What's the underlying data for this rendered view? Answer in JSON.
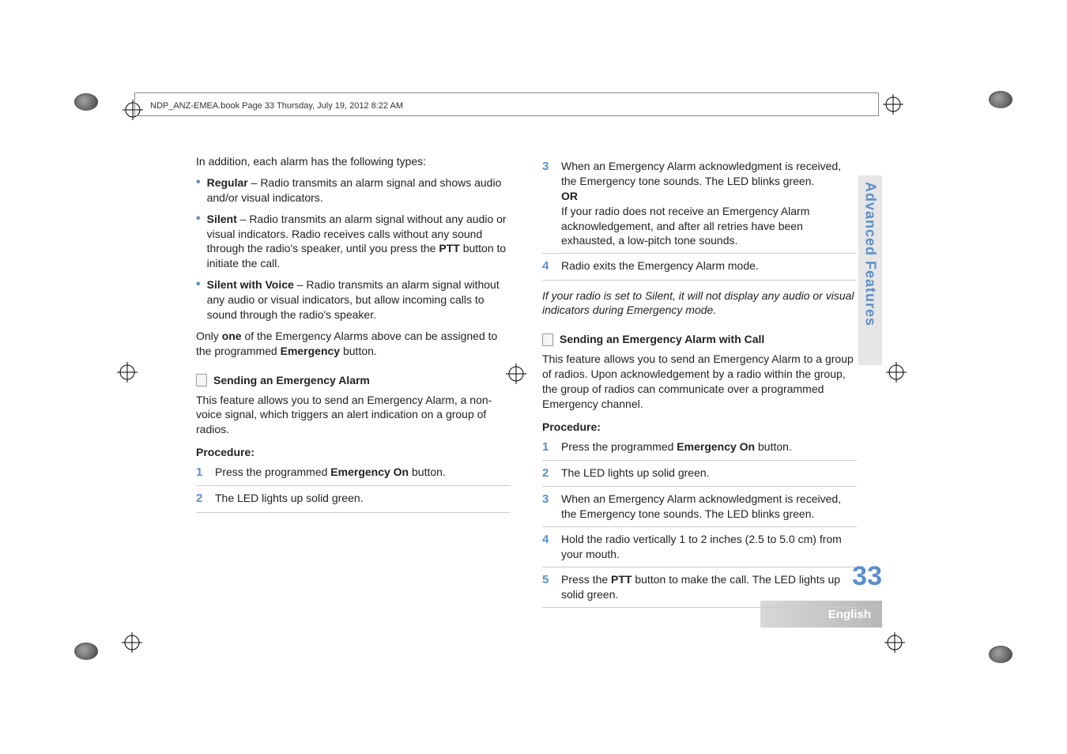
{
  "header": "NDP_ANZ-EMEA.book  Page 33  Thursday, July 19, 2012  8:22 AM",
  "sidebar": "Advanced Features",
  "language": "English",
  "pagenum": "33",
  "left": {
    "intro": "In addition, each alarm has the following types:",
    "bullets": [
      {
        "label": "Regular",
        "sep": " – ",
        "text": "Radio transmits an alarm signal and shows audio and/or visual indicators."
      },
      {
        "label": "Silent",
        "sep": " – ",
        "text": "Radio transmits an alarm signal without any audio or visual indicators. Radio receives calls without any sound through the radio's speaker, until you press the ",
        "bold2": "PTT",
        "tail": " button to initiate the call."
      },
      {
        "label": "Silent with Voice",
        "sep": " – ",
        "text": "Radio transmits an alarm signal without any audio or visual indicators, but allow incoming calls to sound through the radio's speaker."
      }
    ],
    "only_pre": "Only ",
    "only_bold": "one",
    "only_mid": " of the Emergency Alarms above can be assigned to the programmed ",
    "only_bold2": "Emergency",
    "only_post": " button.",
    "sec1_title": "Sending an Emergency Alarm",
    "sec1_body": "This feature allows you to send an Emergency Alarm, a non-voice signal, which triggers an alert indication on a group of radios.",
    "procedure": "Procedure:",
    "steps": [
      {
        "n": "1",
        "pre": "Press the programmed ",
        "bold": "Emergency On",
        "post": " button."
      },
      {
        "n": "2",
        "pre": "The LED lights up solid green.",
        "bold": "",
        "post": ""
      }
    ]
  },
  "right": {
    "steps_a": [
      {
        "n": "3",
        "body1": "When an Emergency Alarm acknowledgment is received, the Emergency tone sounds. The LED blinks green.",
        "or": "OR",
        "body2": "If your radio does not receive an Emergency Alarm acknowledgement, and after all retries have been exhausted, a low-pitch tone sounds."
      },
      {
        "n": "4",
        "body1": "Radio exits the Emergency Alarm mode.",
        "or": "",
        "body2": ""
      }
    ],
    "note": "If your radio is set to Silent, it will not display any audio or visual indicators during Emergency mode.",
    "sec2_title": "Sending an Emergency Alarm with Call",
    "sec2_body": "This feature allows you to send an Emergency Alarm to a group of radios. Upon acknowledgement by a radio within the group, the group of radios can communicate over a programmed Emergency channel.",
    "procedure": "Procedure:",
    "steps_b": [
      {
        "n": "1",
        "pre": "Press the programmed ",
        "bold": "Emergency On",
        "post": " button."
      },
      {
        "n": "2",
        "pre": "The LED lights up solid green.",
        "bold": "",
        "post": ""
      },
      {
        "n": "3",
        "pre": "When an Emergency Alarm acknowledgment is received, the Emergency tone sounds. The LED blinks green.",
        "bold": "",
        "post": ""
      },
      {
        "n": "4",
        "pre": "Hold the radio vertically 1 to 2 inches (2.5 to 5.0 cm) from your mouth.",
        "bold": "",
        "post": ""
      },
      {
        "n": "5",
        "pre": "Press the ",
        "bold": "PTT",
        "post": " button to make the call. The LED lights up solid green."
      }
    ]
  }
}
